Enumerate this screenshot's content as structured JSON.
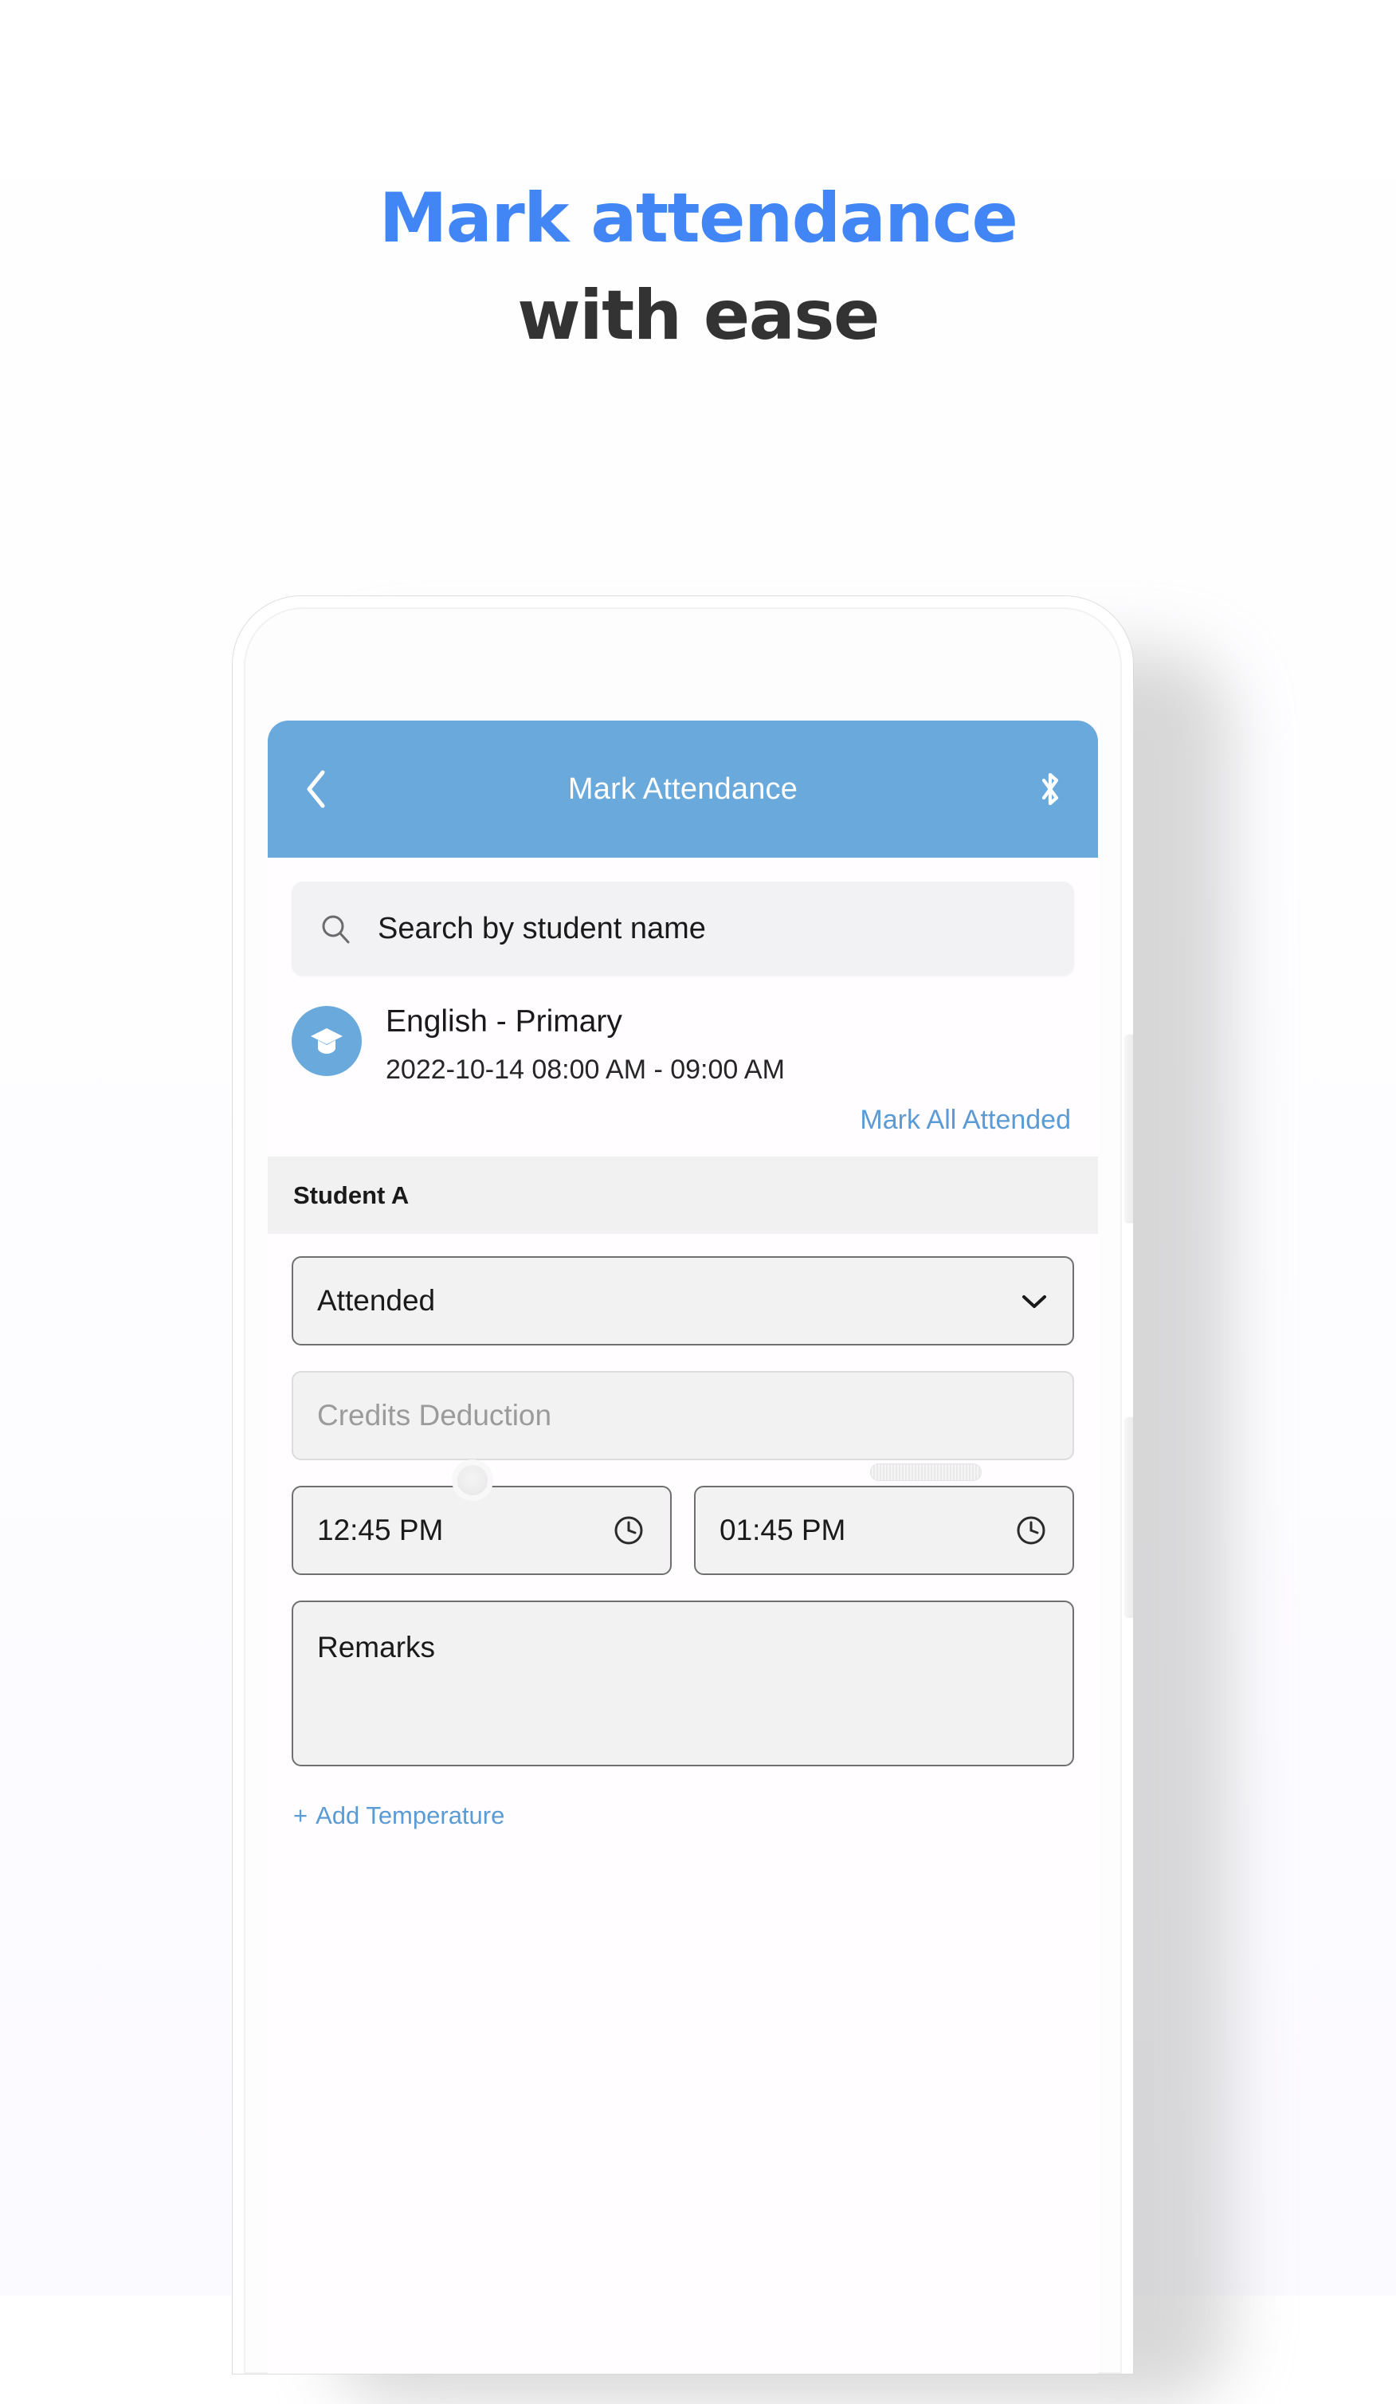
{
  "promo": {
    "headline_line1": "Mark attendance",
    "headline_line2": "with ease",
    "accent_color": "#4285f4",
    "headline_color_secondary": "#333333"
  },
  "appbar": {
    "title": "Mark Attendance",
    "back_icon": "chevron-left-icon",
    "action_icon": "bluetooth-icon",
    "background_color": "#6aa9dc"
  },
  "search": {
    "placeholder": "Search by student name",
    "icon": "search-icon"
  },
  "class_info": {
    "icon": "graduation-cap-icon",
    "title": "English - Primary",
    "schedule": "2022-10-14 08:00 AM - 09:00 AM",
    "mark_all_label": "Mark All Attended",
    "mark_all_color": "#5b9bd5"
  },
  "student": {
    "name": "Student A",
    "status_value": "Attended",
    "status_chevron": "chevron-down-icon",
    "credits_placeholder": "Credits Deduction",
    "time_in": "12:45 PM",
    "time_out": "01:45 PM",
    "time_icon": "clock-icon",
    "remarks_placeholder": "Remarks",
    "add_temperature_plus": "+",
    "add_temperature_label": "Add  Temperature"
  }
}
